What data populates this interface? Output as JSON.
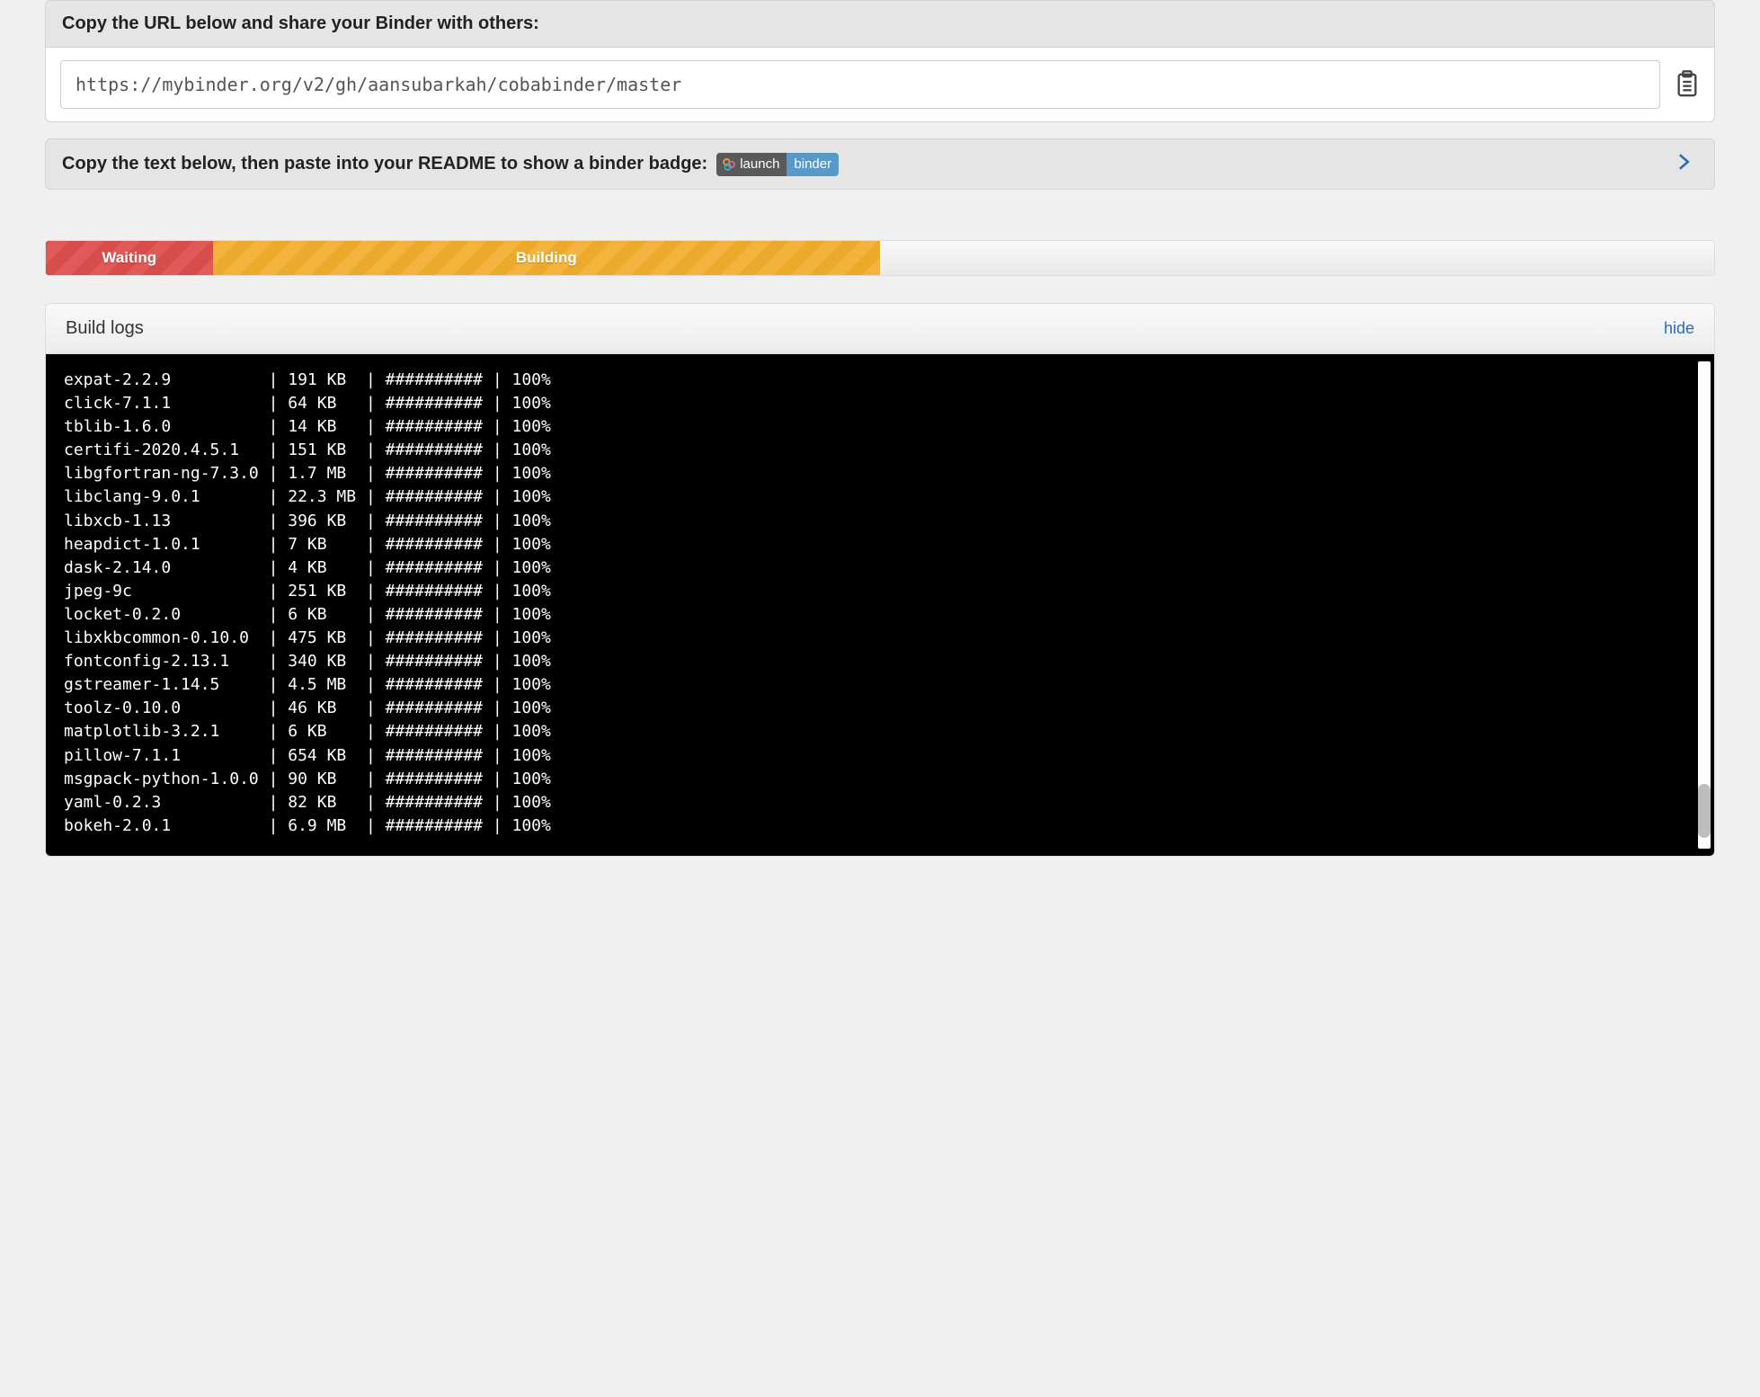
{
  "share_panel": {
    "heading": "Copy the URL below and share your Binder with others:",
    "url": "https://mybinder.org/v2/gh/aansubarkah/cobabinder/master"
  },
  "readme_panel": {
    "text": "Copy the text below, then paste into your README to show a binder badge:",
    "badge_left": "launch",
    "badge_right": "binder"
  },
  "progress": {
    "waiting": "Waiting",
    "building": "Building"
  },
  "logs": {
    "title": "Build logs",
    "hide": "hide",
    "lines": [
      {
        "name": "expat-2.2.9",
        "size": "191 KB",
        "bar": "##########",
        "pct": "100%"
      },
      {
        "name": "click-7.1.1",
        "size": "64 KB",
        "bar": "##########",
        "pct": "100%"
      },
      {
        "name": "tblib-1.6.0",
        "size": "14 KB",
        "bar": "##########",
        "pct": "100%"
      },
      {
        "name": "certifi-2020.4.5.1",
        "size": "151 KB",
        "bar": "##########",
        "pct": "100%"
      },
      {
        "name": "libgfortran-ng-7.3.0",
        "size": "1.7 MB",
        "bar": "##########",
        "pct": "100%"
      },
      {
        "name": "libclang-9.0.1",
        "size": "22.3 MB",
        "bar": "##########",
        "pct": "100%"
      },
      {
        "name": "libxcb-1.13",
        "size": "396 KB",
        "bar": "##########",
        "pct": "100%"
      },
      {
        "name": "heapdict-1.0.1",
        "size": "7 KB",
        "bar": "##########",
        "pct": "100%"
      },
      {
        "name": "dask-2.14.0",
        "size": "4 KB",
        "bar": "##########",
        "pct": "100%"
      },
      {
        "name": "jpeg-9c",
        "size": "251 KB",
        "bar": "##########",
        "pct": "100%"
      },
      {
        "name": "locket-0.2.0",
        "size": "6 KB",
        "bar": "##########",
        "pct": "100%"
      },
      {
        "name": "libxkbcommon-0.10.0",
        "size": "475 KB",
        "bar": "##########",
        "pct": "100%"
      },
      {
        "name": "fontconfig-2.13.1",
        "size": "340 KB",
        "bar": "##########",
        "pct": "100%"
      },
      {
        "name": "gstreamer-1.14.5",
        "size": "4.5 MB",
        "bar": "##########",
        "pct": "100%"
      },
      {
        "name": "toolz-0.10.0",
        "size": "46 KB",
        "bar": "##########",
        "pct": "100%"
      },
      {
        "name": "matplotlib-3.2.1",
        "size": "6 KB",
        "bar": "##########",
        "pct": "100%"
      },
      {
        "name": "pillow-7.1.1",
        "size": "654 KB",
        "bar": "##########",
        "pct": "100%"
      },
      {
        "name": "msgpack-python-1.0.0",
        "size": "90 KB",
        "bar": "##########",
        "pct": "100%"
      },
      {
        "name": "yaml-0.2.3",
        "size": "82 KB",
        "bar": "##########",
        "pct": "100%"
      },
      {
        "name": "bokeh-2.0.1",
        "size": "6.9 MB",
        "bar": "##########",
        "pct": "100%"
      }
    ]
  }
}
